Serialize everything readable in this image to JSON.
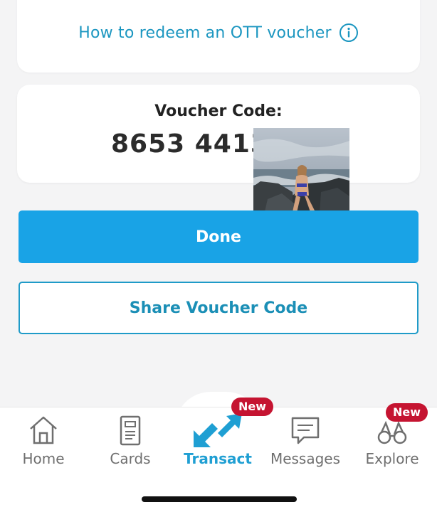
{
  "redeem": {
    "link_text": "How to redeem an OTT voucher",
    "icon": "info-icon"
  },
  "voucher": {
    "label": "Voucher Code:",
    "code": "8653 4413"
  },
  "overlay_image": {
    "icon": "beach-photo"
  },
  "actions": {
    "done_label": "Done",
    "share_label": "Share Voucher Code"
  },
  "tabbar": {
    "items": [
      {
        "label": "Home",
        "icon": "home-icon"
      },
      {
        "label": "Cards",
        "icon": "cards-icon"
      },
      {
        "label": "Transact",
        "icon": "transact-icon",
        "active": true,
        "badge": "New"
      },
      {
        "label": "Messages",
        "icon": "messages-icon"
      },
      {
        "label": "Explore",
        "icon": "explore-icon",
        "badge": "New"
      }
    ]
  },
  "colors": {
    "accent": "#1b96c0",
    "primary_button": "#19a3e6",
    "badge": "#c51431",
    "background": "#f4f4f5"
  }
}
